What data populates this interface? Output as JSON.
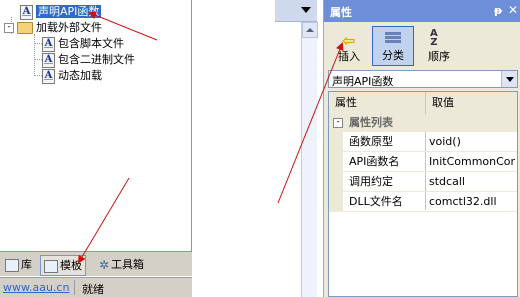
{
  "tree": {
    "root_label": "声明API函数",
    "folder_label": "加载外部文件",
    "children": [
      "包含脚本文件",
      "包含二进制文件",
      "动态加载"
    ],
    "expander_symbol": "-",
    "selection_color": "#316ac5"
  },
  "tabs": {
    "items": [
      "库",
      "模板",
      "工具箱"
    ],
    "active_index": 1
  },
  "status": {
    "url": "www.aau.cn",
    "text": "就绪"
  },
  "props": {
    "title": "属性",
    "pin_symbol": "ᵽ",
    "close_symbol": "✕",
    "toolbar": [
      {
        "label": "插入",
        "icon": "arrow-left-icon"
      },
      {
        "label": "分类",
        "icon": "categorized-icon",
        "active": true
      },
      {
        "label": "顺序",
        "icon": "sort-az-icon"
      }
    ],
    "sort_icon_text": "A\nZ",
    "combo_value": "声明API函数",
    "grid": {
      "col_name": "属性",
      "col_value": "取值",
      "category": "属性列表",
      "category_symbol": "-",
      "rows": [
        {
          "key": "函数原型",
          "value": "void()"
        },
        {
          "key": "API函数名",
          "value": "InitCommonCon..."
        },
        {
          "key": "调用约定",
          "value": "stdcall"
        },
        {
          "key": "DLL文件名",
          "value": "comctl32.dll"
        }
      ]
    },
    "title_bar_color": "#6d8fd8"
  },
  "annotation_color": "#cc1111"
}
